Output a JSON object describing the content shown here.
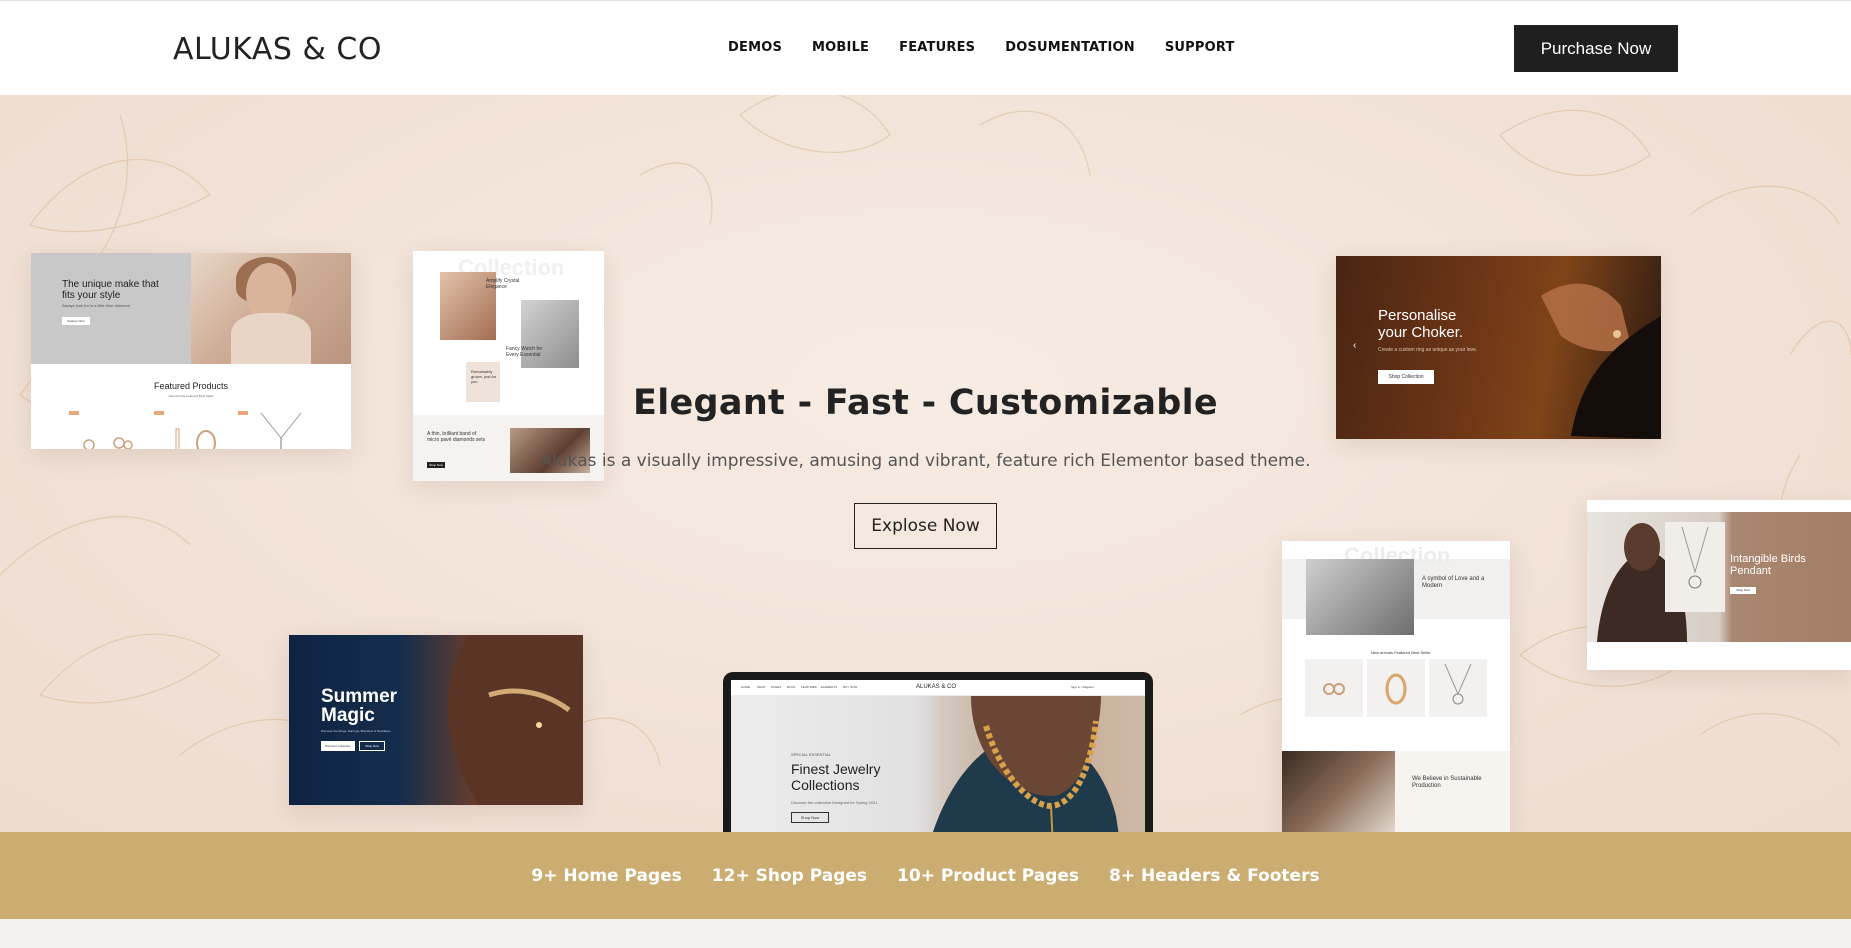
{
  "header": {
    "logo": "ALUKAS & CO",
    "nav": [
      {
        "label": "DEMOS"
      },
      {
        "label": "MOBILE"
      },
      {
        "label": "FEATURES"
      },
      {
        "label": "DOSUMENTATION"
      },
      {
        "label": "SUPPORT"
      }
    ],
    "purchase_label": "Purchase Now"
  },
  "hero": {
    "title": "Elegant - Fast - Customizable",
    "subtitle": "Alukas is a visually impressive, amusing and vibrant, feature rich Elementor based theme.",
    "cta_label": "Explose Now"
  },
  "previews": {
    "featured": {
      "headline": "The unique make that fits your style",
      "tagline": "Always look for in a little blue diamond",
      "button": "Explore Now",
      "section_title": "Featured Products",
      "tabs": "New Arrivals    Featured    Best Seller"
    },
    "collection": {
      "watermark": "Collection",
      "item1": "Amplify Crystal Elegance",
      "item2": "Fancy Watch for Every Essential",
      "item3": "Remarkably grown, just for you",
      "band_text": "A thin, brilliant band of micro pavé diamonds sets",
      "band_button": "Shop Now"
    },
    "personalise": {
      "headline": "Personalise your Choker.",
      "tagline": "Create a custom ring as unique as your love.",
      "button": "Shop Collection"
    },
    "summer": {
      "headline": "Summer Magic",
      "tagline": "Discover the Rings, Earrings, Bracelets & Necklaces",
      "button1": "Discover Collection",
      "button2": "Shop Now"
    },
    "collection_right": {
      "watermark": "Collection",
      "symbol": "A symbol of Love and a Modern",
      "tabs": "New arrivals   Featured   Best Seller",
      "sustain": "We Believe in Sustainable Production"
    },
    "intangible": {
      "headline": "Intangible Birds Pendant",
      "button": "Shop Now"
    },
    "laptop": {
      "logo": "ALUKAS & CO",
      "nav_items": [
        "HOME",
        "SHOP",
        "PAGES",
        "BLOG",
        "FEATURES",
        "ELEMENTS",
        "BUY NOW"
      ],
      "account": "Sign in / Register",
      "special": "SPECIAL ESSENTIAL",
      "headline": "Finest Jewelry Collections",
      "desc": "Discover the collection Designed for Spring 2021",
      "button": "Shop Now"
    }
  },
  "stats": [
    {
      "label": "9+ Home Pages"
    },
    {
      "label": "12+ Shop Pages"
    },
    {
      "label": "10+ Product Pages"
    },
    {
      "label": "8+ Headers & Footers"
    }
  ],
  "colors": {
    "accent_gold": "#cbad72",
    "dark_button": "#1f1f1f",
    "hero_bg": "#f3e5db"
  }
}
